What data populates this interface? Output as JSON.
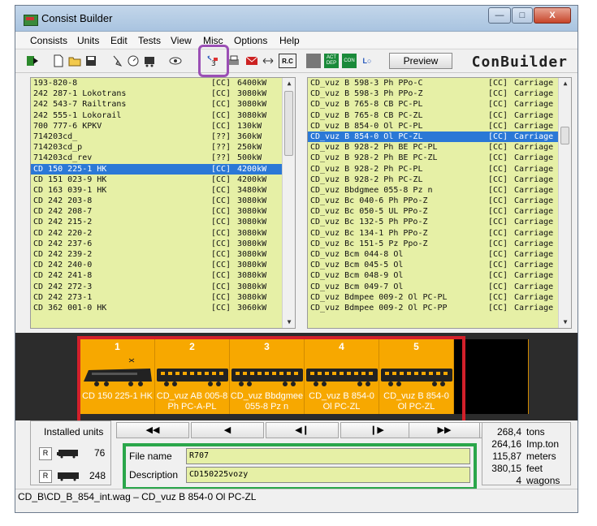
{
  "window": {
    "title": "Consist Builder",
    "min_label": "—",
    "max_label": "□",
    "close_label": "X"
  },
  "menu": [
    "Consists",
    "Units",
    "Edit",
    "Tests",
    "View",
    "Misc",
    "Options",
    "Help"
  ],
  "toolbar": {
    "preview_label": "Preview",
    "brand": "ConBuilder",
    "rc_label": "R.C",
    "icon_labels": [
      "ACT DEP",
      "CON",
      "L○"
    ]
  },
  "left_list": [
    {
      "name": "193-820-8",
      "cc": "[CC]",
      "power": "6400kW"
    },
    {
      "name": "242 287-1 Lokotrans",
      "cc": "[CC]",
      "power": "3080kW"
    },
    {
      "name": "242 543-7 Railtrans",
      "cc": "[CC]",
      "power": "3080kW"
    },
    {
      "name": "242 555-1 Lokorail",
      "cc": "[CC]",
      "power": "3080kW"
    },
    {
      "name": "700 777-6 KPKV",
      "cc": "[CC]",
      "power": "130kW"
    },
    {
      "name": "714203cd_",
      "cc": "[??]",
      "power": "360kW"
    },
    {
      "name": "714203cd_p",
      "cc": "[??]",
      "power": "250kW"
    },
    {
      "name": "714203cd_rev",
      "cc": "[??]",
      "power": "500kW"
    },
    {
      "name": "CD 150 225-1 HK",
      "cc": "[CC]",
      "power": "4200kW",
      "selected": true
    },
    {
      "name": "CD 151 023-9 HK",
      "cc": "[CC]",
      "power": "4200kW"
    },
    {
      "name": "CD 163 039-1 HK",
      "cc": "[CC]",
      "power": "3480kW"
    },
    {
      "name": "CD 242 203-8",
      "cc": "[CC]",
      "power": "3080kW"
    },
    {
      "name": "CD 242 208-7",
      "cc": "[CC]",
      "power": "3080kW"
    },
    {
      "name": "CD 242 215-2",
      "cc": "[CC]",
      "power": "3080kW"
    },
    {
      "name": "CD 242 220-2",
      "cc": "[CC]",
      "power": "3080kW"
    },
    {
      "name": "CD 242 237-6",
      "cc": "[CC]",
      "power": "3080kW"
    },
    {
      "name": "CD 242 239-2",
      "cc": "[CC]",
      "power": "3080kW"
    },
    {
      "name": "CD 242 240-0",
      "cc": "[CC]",
      "power": "3080kW"
    },
    {
      "name": "CD 242 241-8",
      "cc": "[CC]",
      "power": "3080kW"
    },
    {
      "name": "CD 242 272-3",
      "cc": "[CC]",
      "power": "3080kW"
    },
    {
      "name": "CD 242 273-1",
      "cc": "[CC]",
      "power": "3080kW"
    },
    {
      "name": "CD 362 001-0 HK",
      "cc": "[CC]",
      "power": "3060kW"
    }
  ],
  "right_list": [
    {
      "name": "CD_vuz B 598-3 Ph PPo-C",
      "cc": "[CC]",
      "type": "Carriage"
    },
    {
      "name": "CD_vuz B 598-3 Ph PPo-Z",
      "cc": "[CC]",
      "type": "Carriage"
    },
    {
      "name": "CD_vuz B 765-8 CB PC-PL",
      "cc": "[CC]",
      "type": "Carriage"
    },
    {
      "name": "CD_vuz B 765-8 CB PC-ZL",
      "cc": "[CC]",
      "type": "Carriage"
    },
    {
      "name": "CD_vuz B 854-0 Ol PC-PL",
      "cc": "[CC]",
      "type": "Carriage"
    },
    {
      "name": "CD_vuz B 854-0 Ol PC-ZL",
      "cc": "[CC]",
      "type": "Carriage",
      "selected": true
    },
    {
      "name": "CD_vuz B 928-2 Ph BE PC-PL",
      "cc": "[CC]",
      "type": "Carriage"
    },
    {
      "name": "CD_vuz B 928-2 Ph BE PC-ZL",
      "cc": "[CC]",
      "type": "Carriage"
    },
    {
      "name": "CD_vuz B 928-2 Ph PC-PL",
      "cc": "[CC]",
      "type": "Carriage"
    },
    {
      "name": "CD_vuz B 928-2 Ph PC-ZL",
      "cc": "[CC]",
      "type": "Carriage"
    },
    {
      "name": "CD_vuz Bbdgmee 055-8 Pz n",
      "cc": "[CC]",
      "type": "Carriage"
    },
    {
      "name": "CD_vuz Bc 040-6 Ph PPo-Z",
      "cc": "[CC]",
      "type": "Carriage"
    },
    {
      "name": "CD_vuz Bc 050-5 UL PPo-Z",
      "cc": "[CC]",
      "type": "Carriage"
    },
    {
      "name": "CD_vuz Bc 132-5 Ph PPo-Z",
      "cc": "[CC]",
      "type": "Carriage"
    },
    {
      "name": "CD_vuz Bc 134-1 Ph PPo-Z",
      "cc": "[CC]",
      "type": "Carriage"
    },
    {
      "name": "CD_vuz Bc 151-5 Pz Ppo-Z",
      "cc": "[CC]",
      "type": "Carriage"
    },
    {
      "name": "CD_vuz Bcm 044-8 Ol",
      "cc": "[CC]",
      "type": "Carriage"
    },
    {
      "name": "CD_vuz Bcm 045-5 Ol",
      "cc": "[CC]",
      "type": "Carriage"
    },
    {
      "name": "CD_vuz Bcm 048-9 Ol",
      "cc": "[CC]",
      "type": "Carriage"
    },
    {
      "name": "CD_vuz Bcm 049-7 Ol",
      "cc": "[CC]",
      "type": "Carriage"
    },
    {
      "name": "CD_vuz Bdmpee 009-2 Ol PC-PL",
      "cc": "[CC]",
      "type": "Carriage"
    },
    {
      "name": "CD_vuz Bdmpee 009-2 Ol PC-PP",
      "cc": "[CC]",
      "type": "Carriage"
    }
  ],
  "consist": [
    {
      "num": "1",
      "label1": "CD 150 225-1 HK",
      "label2": "",
      "kind": "loco"
    },
    {
      "num": "2",
      "label1": "CD_vuz AB 005-8",
      "label2": "Ph PC-A-PL",
      "kind": "car"
    },
    {
      "num": "3",
      "label1": "CD_vuz Bbdgmee",
      "label2": "055-8 Pz n",
      "kind": "car"
    },
    {
      "num": "4",
      "label1": "CD_vuz B 854-0",
      "label2": "Ol PC-ZL",
      "kind": "car"
    },
    {
      "num": "5",
      "label1": "CD_vuz B 854-0",
      "label2": "Ol PC-ZL",
      "kind": "car"
    }
  ],
  "nav": [
    "◀◀",
    "◀",
    "◀❙",
    "❙▶",
    "▶",
    "▶▶"
  ],
  "installed": {
    "title": "Installed units",
    "r_label": "R",
    "locos": "76",
    "cars": "248"
  },
  "file": {
    "name_label": "File name",
    "name_value": "R707",
    "desc_label": "Description",
    "desc_value": "CD150225vozy"
  },
  "stats": [
    {
      "value": "268,4",
      "unit": "tons"
    },
    {
      "value": "264,16",
      "unit": "Imp.ton"
    },
    {
      "value": "115,87",
      "unit": "meters"
    },
    {
      "value": "380,15",
      "unit": "feet"
    },
    {
      "value": "4",
      "unit": "wagons"
    }
  ],
  "status": "CD_B\\CD_B_854_int.wag – CD_vuz B 854-0 Ol PC-ZL",
  "colors": {
    "list_bg": "#e6f0a6",
    "selection": "#2b78d6",
    "consist_orange": "#f7a800",
    "red_annot": "#d3202a",
    "green_annot": "#2aa64a",
    "purple_annot": "#9b4fb5"
  }
}
